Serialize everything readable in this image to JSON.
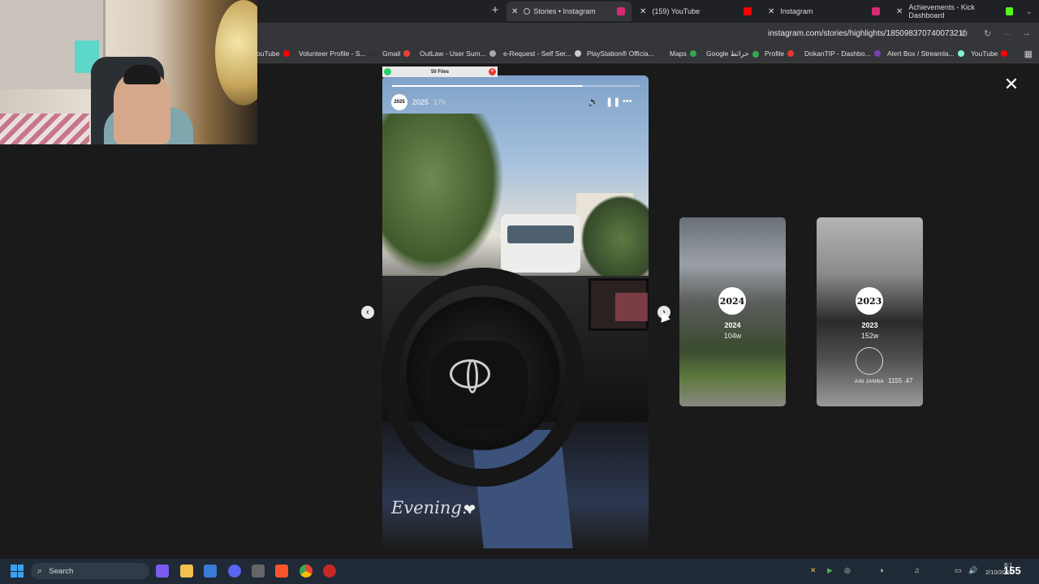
{
  "browser": {
    "tabs": [
      {
        "label": "Stories • Instagram",
        "active": true
      },
      {
        "label": "(159) YouTube",
        "active": false
      },
      {
        "label": "Instagram",
        "active": false
      },
      {
        "label": "Achievements - Kick Dashboard",
        "active": false
      }
    ],
    "url": "instagram.com/stories/highlights/18509837074007321/",
    "bookmarks": [
      "ouTube",
      "Volunteer Profile - S...",
      "Gmail",
      "OutLaw - User Sum...",
      "e-Request - Self Ser...",
      "PlayStation® Officia...",
      "Maps",
      "Google خرائط",
      "Profile",
      "DokanTIP - Dashbo...",
      "Alert Box / Streamla...",
      "YouTube"
    ]
  },
  "overlay": {
    "files_label": "50 Files"
  },
  "story": {
    "avatar_text": "2025",
    "username": "2025",
    "time": "17h",
    "caption": "Evening..",
    "progress": 0.77
  },
  "highlights": [
    {
      "circle": "2024",
      "label": "2024",
      "age": "104w"
    },
    {
      "circle": "2023",
      "label": "2023",
      "age": "152w"
    }
  ],
  "highlight_overlay": {
    "watch_text": "AIN JANNA",
    "time_text": "1155 .47"
  },
  "taskbar": {
    "search_placeholder": "Search",
    "clock_time": "8:1",
    "clock_date": "2/10/2026",
    "kick_count": "155"
  },
  "icons": [
    "windows-icon",
    "search-icon",
    "file-explorer-icon",
    "store-icon",
    "discord-icon",
    "brave-icon",
    "chrome-icon",
    "close-icon",
    "pause-icon",
    "volume-icon",
    "more-icon"
  ]
}
